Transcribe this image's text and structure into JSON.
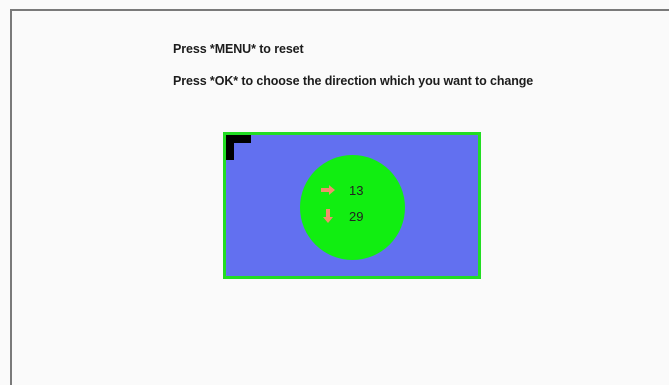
{
  "instructions": {
    "reset": "Press *MENU* to reset",
    "choose": "Press *OK* to choose the direction which you want to change"
  },
  "panel": {
    "horizontal": {
      "icon": "arrow-right-icon",
      "value": "13"
    },
    "vertical": {
      "icon": "arrow-down-icon",
      "value": "29"
    }
  },
  "colors": {
    "background": "#fafafa",
    "panel_fill": "#6270f0",
    "panel_border": "#22dd22",
    "circle_fill": "#11ee11",
    "arrow": "#f0906c",
    "corner_marker": "#000000"
  }
}
